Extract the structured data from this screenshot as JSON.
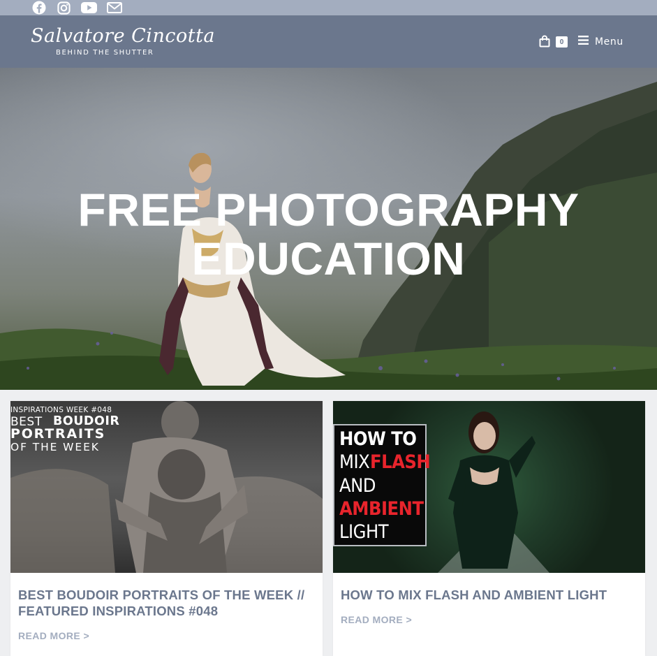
{
  "topbar": {
    "social_icons": [
      "facebook-icon",
      "instagram-icon",
      "youtube-icon",
      "email-icon"
    ]
  },
  "header": {
    "logo_script": "Salvatore Cincotta",
    "logo_sub": "BEHIND THE SHUTTER",
    "cart_count": "0",
    "menu_label": "Menu"
  },
  "hero": {
    "title_line1": "FREE PHOTOGRAPHY",
    "title_line2": "EDUCATION"
  },
  "cards": [
    {
      "image_lines": [
        "INSPIRATIONS WEEK #048",
        "BEST",
        "BOUDOIR",
        "PORTRAITS",
        "OF THE WEEK"
      ],
      "title": "BEST BOUDOIR PORTRAITS OF THE WEEK // FEATURED INSPIRATIONS #048",
      "read_more": "READ MORE >"
    },
    {
      "image_lines": [
        "HOW TO",
        "MIX",
        "FLASH",
        "AND",
        "AMBIENT",
        "LIGHT"
      ],
      "title": "HOW TO MIX FLASH AND AMBIENT LIGHT",
      "read_more": "READ MORE >"
    }
  ],
  "colors": {
    "topbar": "#a3adbf",
    "header": "#6b778d",
    "card_title": "#6b778d",
    "read_more": "#a3adbf",
    "accent_red": "#e8242c"
  }
}
